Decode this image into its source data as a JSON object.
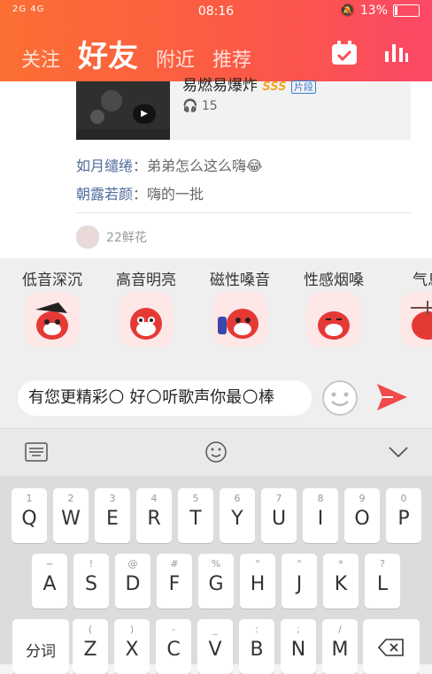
{
  "status_bar": {
    "network": "2G 4G",
    "time": "08:16",
    "battery": "13%"
  },
  "header": {
    "tabs": [
      "关注",
      "好友",
      "附近",
      "推荐"
    ],
    "active_tab": "好友"
  },
  "feed": {
    "song": {
      "title": "易燃易爆炸",
      "badge_sss": "SSS",
      "badge_clip": "片段",
      "plays": "15"
    },
    "comments": [
      {
        "user": "如月缱绻",
        "sep": "：",
        "text": "弟弟怎么这么嗨😂"
      },
      {
        "user": "朝露若颜",
        "sep": "：",
        "text": "嗨的一批"
      }
    ],
    "flowers": "22鲜花"
  },
  "stickers": [
    {
      "caption": "低音深沉",
      "color": "#e53935"
    },
    {
      "caption": "高音明亮",
      "color": "#e53935"
    },
    {
      "caption": "磁性嗓音",
      "color": "#e53935"
    },
    {
      "caption": "性感烟嗓",
      "color": "#e53935"
    },
    {
      "caption": "气息",
      "color": "#e53935"
    }
  ],
  "input": {
    "value": "有您更精彩🌕 好🌕听歌声你最🌕棒"
  },
  "keyboard": {
    "row1": [
      [
        "1",
        "Q"
      ],
      [
        "2",
        "W"
      ],
      [
        "3",
        "E"
      ],
      [
        "4",
        "R"
      ],
      [
        "5",
        "T"
      ],
      [
        "6",
        "Y"
      ],
      [
        "7",
        "U"
      ],
      [
        "8",
        "I"
      ],
      [
        "9",
        "O"
      ],
      [
        "0",
        "P"
      ]
    ],
    "row2": [
      [
        "~",
        "A"
      ],
      [
        "!",
        "S"
      ],
      [
        "@",
        "D"
      ],
      [
        "#",
        "F"
      ],
      [
        "%",
        "G"
      ],
      [
        "\"",
        "H"
      ],
      [
        "\"",
        "J"
      ],
      [
        "*",
        "K"
      ],
      [
        "?",
        "L"
      ]
    ],
    "row3": [
      [
        "(",
        "Z"
      ],
      [
        ")",
        "X"
      ],
      [
        "-",
        "C"
      ],
      [
        "_",
        "V"
      ],
      [
        ":",
        "B"
      ],
      [
        ";",
        "N"
      ],
      [
        "/",
        "M"
      ]
    ],
    "fenci": "分词"
  },
  "colors": {
    "accent": "#fb5a45",
    "send": "#f04a4a"
  }
}
